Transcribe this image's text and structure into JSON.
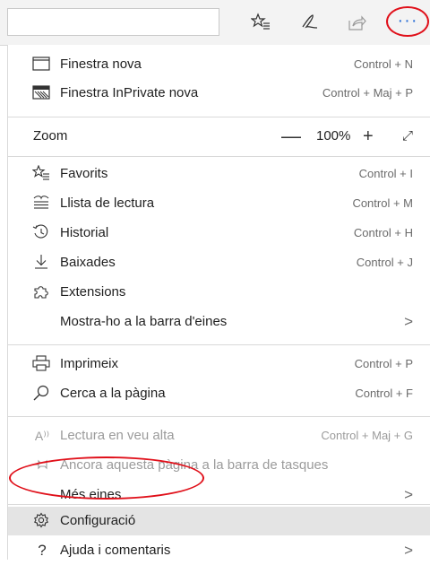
{
  "menu": {
    "new_window": {
      "label": "Finestra nova",
      "shortcut": "Control + N"
    },
    "new_inprivate": {
      "label": "Finestra InPrivate nova",
      "shortcut": "Control + Maj + P"
    },
    "zoom": {
      "label": "Zoom",
      "minus": "—",
      "value": "100%",
      "plus": "+"
    },
    "favorites": {
      "label": "Favorits",
      "shortcut": "Control + I"
    },
    "reading_list": {
      "label": "Llista de lectura",
      "shortcut": "Control + M"
    },
    "history": {
      "label": "Historial",
      "shortcut": "Control + H"
    },
    "downloads": {
      "label": "Baixades",
      "shortcut": "Control + J"
    },
    "extensions": {
      "label": "Extensions"
    },
    "show_toolbar": {
      "label": "Mostra-ho a la barra d'eines"
    },
    "print": {
      "label": "Imprimeix",
      "shortcut": "Control + P"
    },
    "find": {
      "label": "Cerca a la pàgina",
      "shortcut": "Control + F"
    },
    "read_aloud": {
      "label": "Lectura en veu alta",
      "shortcut": "Control + Maj + G",
      "icon_text": "A⁾⁾"
    },
    "pin_taskbar": {
      "label": "Ancora aquesta pàgina a la barra de tasques"
    },
    "more_tools": {
      "label": "Més eines"
    },
    "settings": {
      "label": "Configuració"
    },
    "help": {
      "label": "Ajuda i comentaris",
      "icon_text": "?"
    }
  },
  "toolbar": {
    "more_label": "···"
  },
  "colors": {
    "annotation": "#e0101a",
    "accent": "#2b6fd6",
    "highlight": "#e4e4e4"
  }
}
